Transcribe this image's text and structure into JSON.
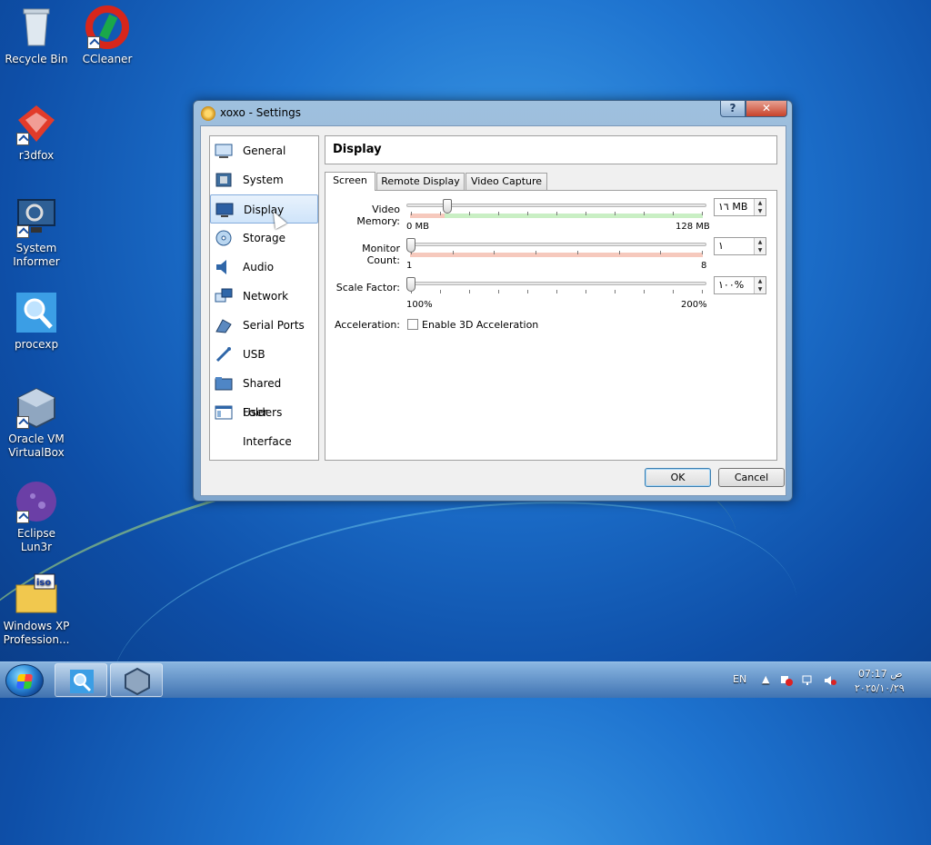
{
  "desktop": {
    "icons": [
      {
        "label": "Recycle Bin",
        "icon": "recycle-bin-icon"
      },
      {
        "label": "CCleaner",
        "icon": "ccleaner-icon"
      },
      {
        "label": "r3dfox",
        "icon": "r3dfox-icon"
      },
      {
        "label": "System Informer",
        "icon": "system-informer-icon"
      },
      {
        "label": "procexp",
        "icon": "procexp-icon"
      },
      {
        "label": "Oracle VM VirtualBox",
        "icon": "virtualbox-icon"
      },
      {
        "label": "Eclipse Lun3r",
        "icon": "eclipse-icon"
      },
      {
        "label": "Windows XP Profession...",
        "icon": "iso-folder-icon"
      }
    ]
  },
  "window": {
    "title": "xoxo - Settings",
    "help_label": "?",
    "close_label": "✕",
    "nav": [
      {
        "label": "General",
        "icon": "general-icon"
      },
      {
        "label": "System",
        "icon": "system-chip-icon"
      },
      {
        "label": "Display",
        "icon": "monitor-icon",
        "selected": true
      },
      {
        "label": "Storage",
        "icon": "storage-disc-icon"
      },
      {
        "label": "Audio",
        "icon": "speaker-icon"
      },
      {
        "label": "Network",
        "icon": "network-icon"
      },
      {
        "label": "Serial Ports",
        "icon": "serial-ports-icon"
      },
      {
        "label": "USB",
        "icon": "usb-icon"
      },
      {
        "label": "Shared Folders",
        "icon": "folder-icon"
      },
      {
        "label": "User Interface",
        "icon": "user-interface-icon"
      }
    ],
    "section_title": "Display",
    "tabs": [
      {
        "label": "Screen",
        "active": true
      },
      {
        "label": "Remote Display",
        "active": false
      },
      {
        "label": "Video Capture",
        "active": false
      }
    ],
    "video_memory": {
      "label": "Video Memory:",
      "value": "١٦ MB",
      "min_label": "0 MB",
      "max_label": "128 MB",
      "position_fraction": 0.125
    },
    "monitor_count": {
      "label": "Monitor Count:",
      "value": "١",
      "min_label": "1",
      "max_label": "8",
      "position_fraction": 0.0
    },
    "scale_factor": {
      "label": "Scale Factor:",
      "value": "١٠٠%",
      "min_label": "100%",
      "max_label": "200%",
      "position_fraction": 0.0
    },
    "acceleration": {
      "label": "Acceleration:",
      "checkbox_label": "Enable 3D Acceleration",
      "checked": false
    },
    "ok_label": "OK",
    "cancel_label": "Cancel"
  },
  "taskbar": {
    "language": "EN",
    "time": "07:17 ص",
    "date": "٢٠٢٥/١٠/٢٩",
    "tasks": [
      "procexp-task-icon",
      "virtualbox-task-icon"
    ]
  },
  "colors": {
    "accent": "#3399ff",
    "green_band": "#c9efc4",
    "red_band": "#f6c9bd"
  }
}
